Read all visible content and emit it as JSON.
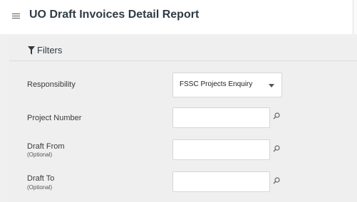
{
  "header": {
    "title": "UO Draft Invoices Detail Report",
    "menu_icon": "hamburger-menu-icon"
  },
  "filters": {
    "heading": "Filters",
    "icon": "funnel-icon",
    "responsibility": {
      "label": "Responsibility",
      "selected": "FSSC Projects Enquiry"
    },
    "project_number": {
      "label": "Project Number",
      "value": ""
    },
    "draft_from": {
      "label": "Draft From",
      "sublabel": "(Optional)",
      "value": ""
    },
    "draft_to": {
      "label": "Draft To",
      "sublabel": "(Optional)",
      "value": ""
    }
  },
  "colors": {
    "title": "#2f3b45",
    "panel_bg": "#efefef",
    "field_border": "#d6d6d6"
  }
}
